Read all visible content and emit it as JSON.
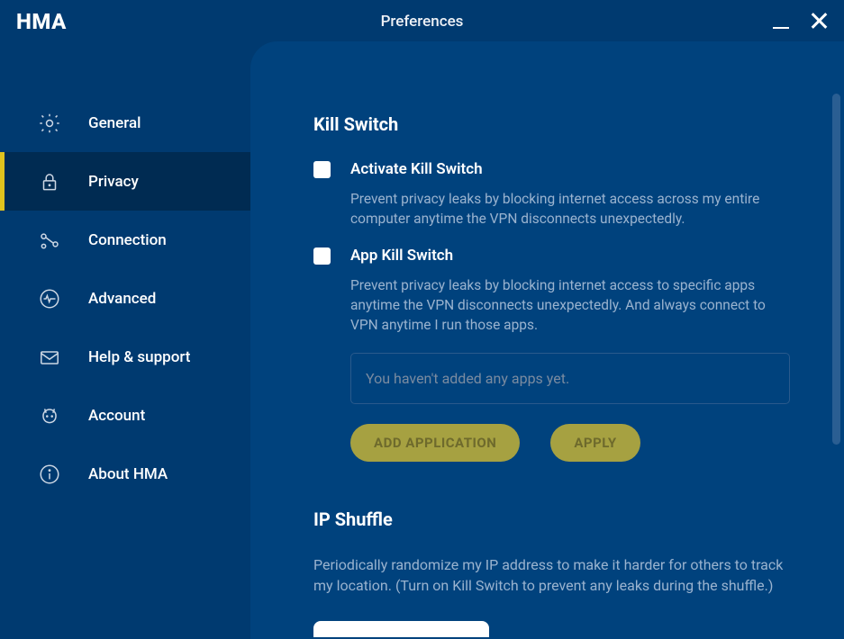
{
  "app": {
    "logo": "HMA",
    "title": "Preferences"
  },
  "sidebar": {
    "items": [
      {
        "label": "General"
      },
      {
        "label": "Privacy"
      },
      {
        "label": "Connection"
      },
      {
        "label": "Advanced"
      },
      {
        "label": "Help & support"
      },
      {
        "label": "Account"
      },
      {
        "label": "About HMA"
      }
    ],
    "active_index": 1
  },
  "killswitch": {
    "title": "Kill Switch",
    "activate": {
      "label": "Activate Kill Switch",
      "desc": "Prevent privacy leaks by blocking internet access across my entire computer anytime the VPN disconnects unexpectedly."
    },
    "appks": {
      "label": "App Kill Switch",
      "desc": "Prevent privacy leaks by blocking internet access to specific apps anytime the VPN disconnects unexpectedly. And always connect to VPN anytime I run those apps."
    },
    "empty_apps": "You haven't added any apps yet.",
    "add_btn": "ADD APPLICATION",
    "apply_btn": "APPLY"
  },
  "ipshuffle": {
    "title": "IP Shuffle",
    "desc": "Periodically randomize my IP address to make it harder for others to track my location. (Turn on Kill Switch to prevent any leaks during the shuffle.)"
  }
}
